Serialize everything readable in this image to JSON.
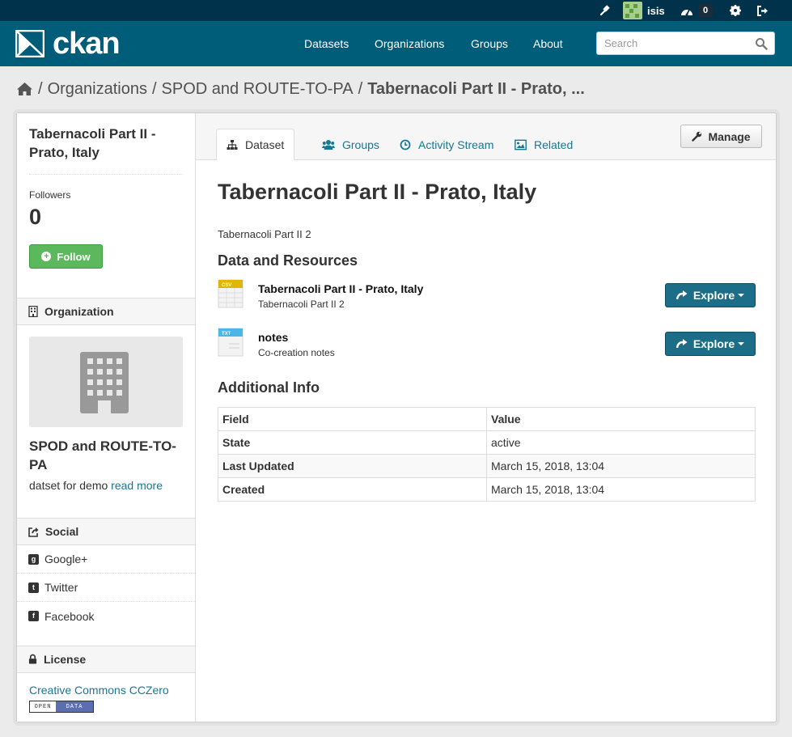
{
  "account": {
    "username": "isis",
    "dashboard_count": "0"
  },
  "brand": {
    "logo_text": "ckan"
  },
  "nav": {
    "datasets": "Datasets",
    "organizations": "Organizations",
    "groups": "Groups",
    "about": "About"
  },
  "search": {
    "placeholder": "Search"
  },
  "breadcrumb": {
    "sep": "/",
    "organizations": "Organizations",
    "organization": "SPOD and ROUTE-TO-PA",
    "current": "Tabernacoli Part II - Prato, ..."
  },
  "sidebar": {
    "dataset_title": "Tabernacoli Part II - Prato, Italy",
    "followers_label": "Followers",
    "followers_count": "0",
    "follow_label": "Follow",
    "organization_heading": "Organization",
    "org_name": "SPOD and ROUTE-TO-PA",
    "org_description": "datset for demo",
    "read_more": "read more",
    "social_heading": "Social",
    "social": [
      {
        "label": "Google+",
        "icon": "google-plus-icon"
      },
      {
        "label": "Twitter",
        "icon": "twitter-icon"
      },
      {
        "label": "Facebook",
        "icon": "facebook-icon"
      }
    ],
    "license_heading": "License",
    "license_link": "Creative Commons CCZero",
    "open_data_badge": {
      "left": "OPEN",
      "right": "DATA"
    }
  },
  "tabs": [
    {
      "label": "Dataset",
      "icon": "sitemap-icon",
      "active": true
    },
    {
      "label": "Groups",
      "icon": "users-icon",
      "active": false
    },
    {
      "label": "Activity Stream",
      "icon": "clock-icon",
      "active": false
    },
    {
      "label": "Related",
      "icon": "picture-icon",
      "active": false
    }
  ],
  "manage_label": "Manage",
  "dataset": {
    "title": "Tabernacoli Part II - Prato, Italy",
    "notes": "Tabernacoli Part II 2",
    "resources_heading": "Data and Resources",
    "resources": [
      {
        "title": "Tabernacoli Part II - Prato, Italy",
        "description": "Tabernacoli Part II 2",
        "format": "CSV",
        "format_color": "#e2b600",
        "explore_label": "Explore"
      },
      {
        "title": "notes",
        "description": "Co-creation notes",
        "format": "TXT",
        "format_color": "#4db6e6",
        "explore_label": "Explore"
      }
    ],
    "additional_heading": "Additional Info",
    "table": {
      "headers": [
        "Field",
        "Value"
      ],
      "rows": [
        [
          "State",
          "active"
        ],
        [
          "Last Updated",
          "March 15, 2018, 13:04"
        ],
        [
          "Created",
          "March 15, 2018, 13:04"
        ]
      ]
    }
  },
  "colors": {
    "masthead": "#005d7a",
    "account_bar": "#00334b",
    "link": "#187794",
    "follow_green": "#5cb85c",
    "explore_blue": "#1c6d87"
  }
}
